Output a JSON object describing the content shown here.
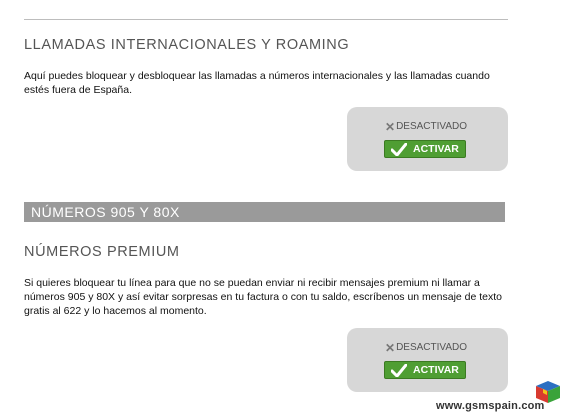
{
  "section1": {
    "title": "LLAMADAS INTERNACIONALES Y ROAMING",
    "description": "Aquí puedes bloquear y desbloquear las llamadas a números internacionales y las llamadas cuando estés fuera de España.",
    "status_label": "DESACTIVADO",
    "button_label": "ACTIVAR"
  },
  "band": {
    "label": "NÚMEROS 905 Y 80X"
  },
  "section2": {
    "title": "NÚMEROS PREMIUM",
    "description": "Si quieres bloquear tu línea para que no se puedan enviar ni recibir mensajes premium ni llamar a números 905 y 80X y así evitar sorpresas en tu factura o con tu saldo, escríbenos un mensaje de texto gratis al 622 y lo hacemos al momento.",
    "status_label": "DESACTIVADO",
    "button_label": "ACTIVAR"
  },
  "watermark": {
    "text": "www.gsmspain.com"
  },
  "colors": {
    "accent_green": "#4f9e33",
    "band_gray": "#9a9a9a",
    "status_box_gray": "#d7d7d7"
  },
  "icons": [
    "x-icon",
    "check-icon",
    "cube-logo-icon"
  ]
}
